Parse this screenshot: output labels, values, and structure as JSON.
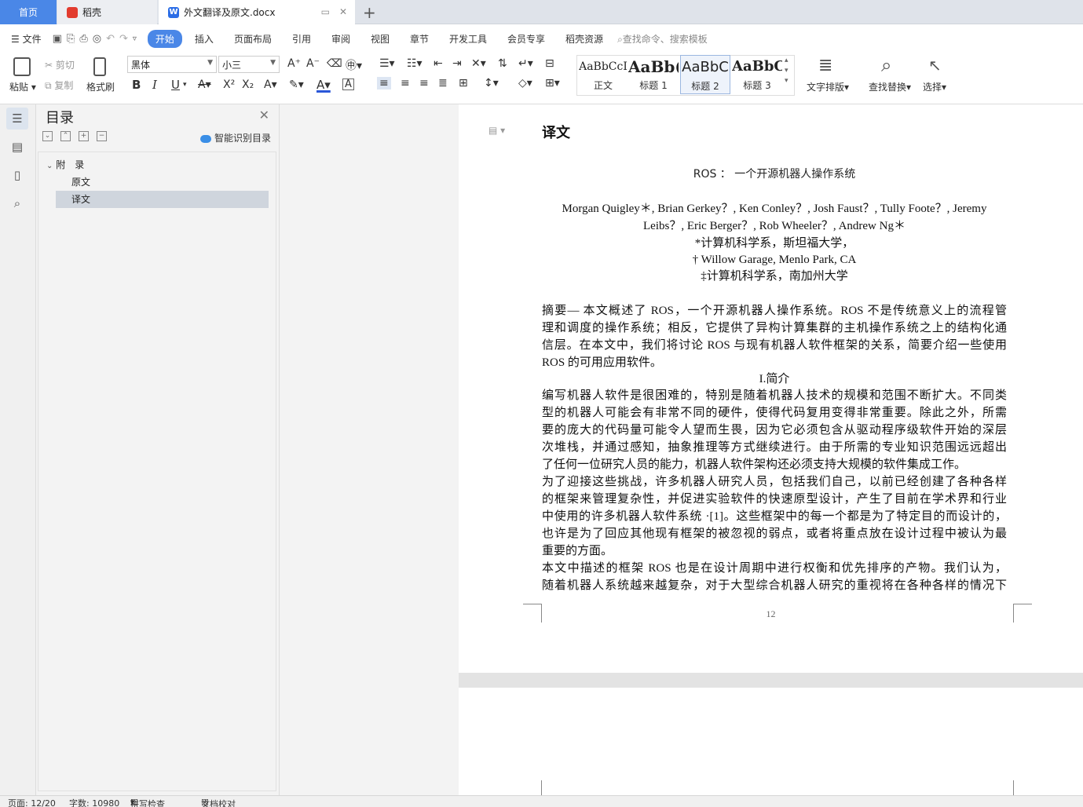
{
  "tabs": {
    "home": "首页",
    "daoke": "稻壳",
    "document": "外文翻译及原文.docx",
    "doc_icon": "W"
  },
  "menu": {
    "file": "文件",
    "items": [
      "开始",
      "插入",
      "页面布局",
      "引用",
      "审阅",
      "视图",
      "章节",
      "开发工具",
      "会员专享",
      "稻壳资源"
    ],
    "search_placeholder": "查找命令、搜索模板"
  },
  "ribbon": {
    "paste": "粘贴",
    "cut": "剪切",
    "copy": "复制",
    "format_painter": "格式刷",
    "font": "黑体",
    "font_size": "小三",
    "styles": [
      {
        "sample": "AaBbCcI",
        "label": "正文"
      },
      {
        "sample": "AaBb(",
        "label": "标题 1"
      },
      {
        "sample": "AaBbC",
        "label": "标题 2"
      },
      {
        "sample": "AaBbC",
        "label": "标题 3"
      }
    ],
    "text_layout": "文字排版",
    "find_replace": "查找替换",
    "select": "选择",
    "bold": "B",
    "italic": "I",
    "underline": "U"
  },
  "toc": {
    "title": "目录",
    "smart": "智能识别目录",
    "nodes": [
      "附　录",
      "原文",
      "译文"
    ]
  },
  "document": {
    "heading": "译文",
    "title": "ROS ： 一个开源机器人操作系统",
    "authors": [
      "Morgan Quigley＊, Brian Gerkey？, Ken Conley？, Josh Faust？, Tully Foote？, Jeremy",
      "Leibs？, Eric Berger？, Rob Wheeler？, Andrew Ng＊"
    ],
    "affiliations": [
      "*计算机科学系，斯坦福大学，",
      "† Willow Garage, Menlo Park, CA",
      "‡计算机科学系，南加州大学"
    ],
    "abstract": [
      "摘要— 本文概述了 ROS，一个开源机器人操作系统。ROS 不是传统意义上的流程管",
      "理和调度的操作系统；相反，它提供了异构计算集群的主机操作系统之上的结构化通",
      "信层。在本文中，我们将讨论 ROS 与现有机器人软件框架的关系，简要介绍一些使用",
      "ROS 的可用应用软件。"
    ],
    "section": "I.简介",
    "para1": [
      "编写机器人软件是很困难的，特别是随着机器人技术的规模和范围不断扩大。不同类",
      "型的机器人可能会有非常不同的硬件，使得代码复用变得非常重要。除此之外，所需",
      "要的庞大的代码量可能令人望而生畏，因为它必须包含从驱动程序级软件开始的深层",
      "次堆栈，并通过感知，抽象推理等方式继续进行。由于所需的专业知识范围远远超出",
      "了任何一位研究人员的能力，机器人软件架构还必须支持大规模的软件集成工作。"
    ],
    "para2": [
      "为了迎接这些挑战，许多机器人研究人员，包括我们自己，以前已经创建了各种各样",
      "的框架来管理复杂性，并促进实验软件的快速原型设计，产生了目前在学术界和行业",
      "中使用的许多机器人软件系统 ·[1]。这些框架中的每一个都是为了特定目的而设计的，",
      "也许是为了回应其他现有框架的被忽视的弱点，或者将重点放在设计过程中被认为最",
      "重要的方面。"
    ],
    "para3": [
      "本文中描述的框架 ROS 也是在设计周期中进行权衡和优先排序的产物。我们认为，",
      "随着机器人系统越来越复杂，对于大型综合机器人研究的重视将在各种各样的情况下"
    ],
    "page_number": "12"
  },
  "status": {
    "page": "页面: 12/20",
    "words": "字数: 10980",
    "spell": "拼写检查",
    "proof": "文档校对"
  }
}
